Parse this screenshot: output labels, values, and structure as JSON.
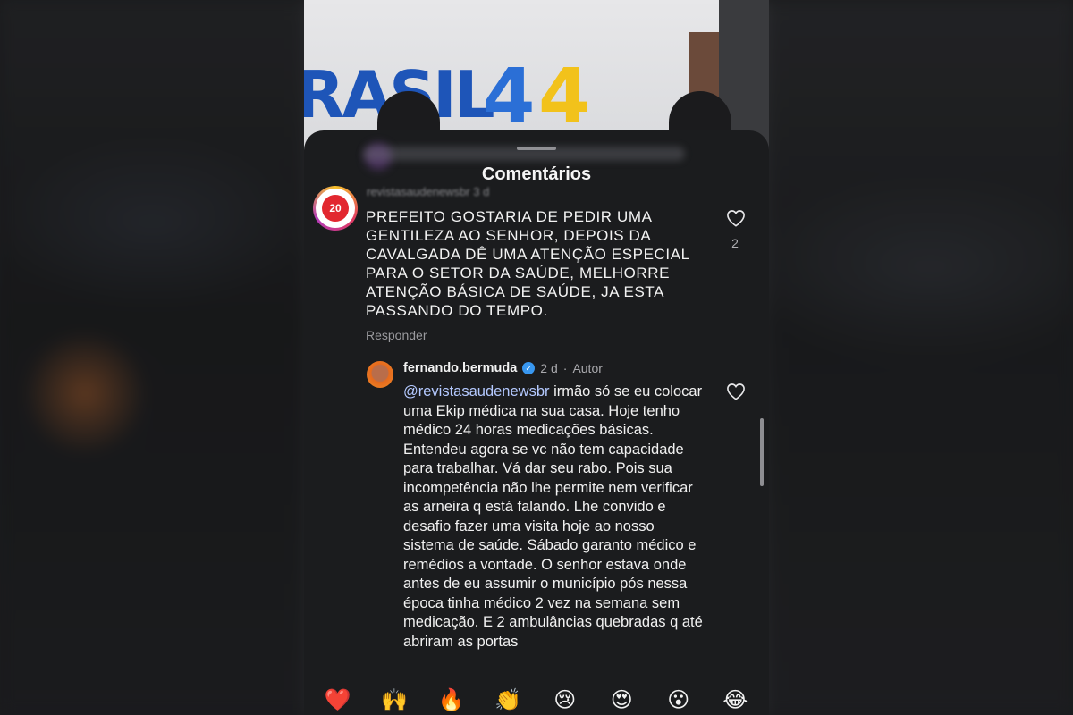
{
  "background": {
    "video_logo_text": "RASIL",
    "video_logo_number_a": "4",
    "video_logo_number_b": "4"
  },
  "sheet": {
    "title": "Comentários",
    "colors": {
      "background": "#1b1c1e",
      "mention": "#b4c9ff",
      "verified": "#3897f0",
      "like_heart": "#e8293d"
    }
  },
  "comment_top": {
    "username": "revistasaudenewsbr",
    "time": "3 d",
    "avatar_badge": "20",
    "text": "PREFEITO GOSTARIA DE PEDIR UMA GENTILEZA AO SENHOR, DEPOIS DA CAVALGADA DÊ UMA ATENÇÃO ESPECIAL PARA O SETOR DA SAÚDE, MELHORRE ATENÇÃO BÁSICA DE SAÚDE, JA ESTA PASSANDO DO TEMPO.",
    "reply_label": "Responder",
    "like_count": "2",
    "like_icon": "heart-outline-icon"
  },
  "comment_reply": {
    "username": "fernando.bermuda",
    "verified_icon": "verified-badge-icon",
    "time": "2 d",
    "separator": "·",
    "author_label": "Autor",
    "mention": "@revistasaudenewsbr",
    "text": " irmão só se eu colocar  uma Ekip médica na sua casa. Hoje tenho médico 24 horas medicações básicas. Entendeu  agora se vc não tem capacidade para trabalhar. Vá dar seu rabo. Pois sua incompetência não lhe permite nem verificar as arneira q está falando. Lhe convido e desafio fazer uma visita hoje ao nosso sistema de saúde. Sábado garanto médico e remédios a vontade.  O senhor estava onde antes de eu assumir o município pós nessa época tinha médico 2 vez na semana sem medicação. E 2 ambulâncias quebradas q até abriram as portas",
    "like_icon": "heart-outline-icon"
  },
  "emoji_bar": [
    {
      "name": "heart-emoji",
      "char": "❤️"
    },
    {
      "name": "raised-hands-emoji",
      "char": "🙌"
    },
    {
      "name": "fire-emoji",
      "char": "🔥"
    },
    {
      "name": "clapping-hands-emoji",
      "char": "👏"
    },
    {
      "name": "crying-face-emoji",
      "char": "😢"
    },
    {
      "name": "heart-eyes-emoji",
      "char": "😍"
    },
    {
      "name": "surprised-face-emoji",
      "char": "😮"
    },
    {
      "name": "tears-of-joy-emoji",
      "char": "😂"
    }
  ]
}
